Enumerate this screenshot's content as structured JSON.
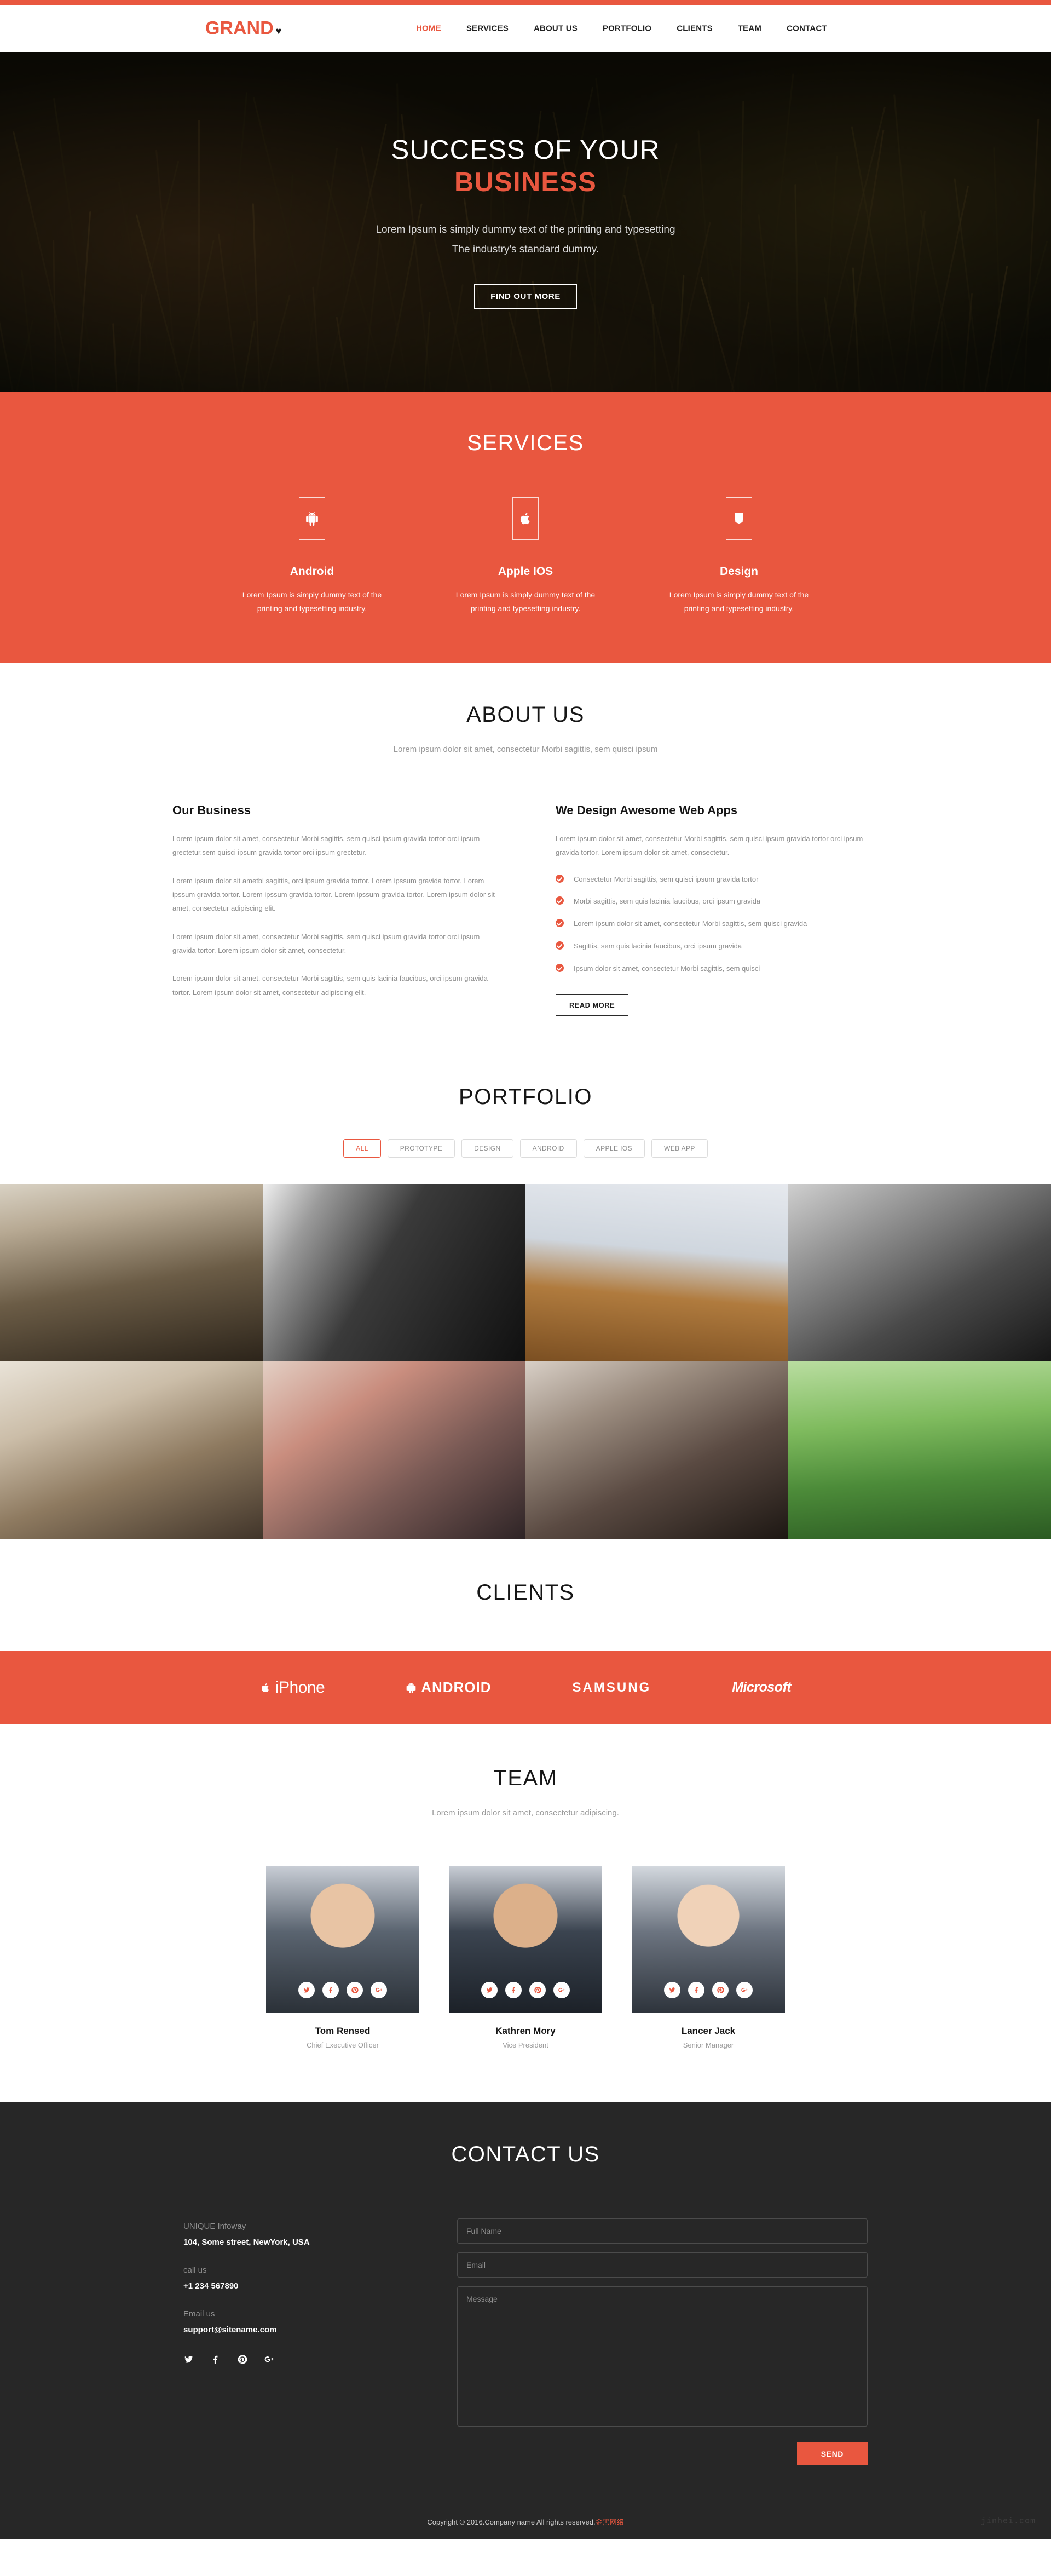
{
  "brand": {
    "name": "GRAND",
    "mark": "♥"
  },
  "nav": {
    "items": [
      {
        "label": "HOME",
        "active": true
      },
      {
        "label": "SERVICES",
        "active": false
      },
      {
        "label": "ABOUT US",
        "active": false
      },
      {
        "label": "PORTFOLIO",
        "active": false
      },
      {
        "label": "CLIENTS",
        "active": false
      },
      {
        "label": "TEAM",
        "active": false
      },
      {
        "label": "CONTACT",
        "active": false
      }
    ]
  },
  "hero": {
    "title_line1": "SUCCESS OF YOUR",
    "title_line2": "BUSINESS",
    "sub_line1": "Lorem Ipsum is simply dummy text of the printing and typesetting",
    "sub_line2": "The industry's standard dummy.",
    "button": "FIND OUT MORE"
  },
  "services": {
    "title": "SERVICES",
    "items": [
      {
        "icon": "android-icon",
        "name": "Android",
        "desc": "Lorem Ipsum is simply dummy text of the printing and typesetting industry."
      },
      {
        "icon": "apple-icon",
        "name": "Apple IOS",
        "desc": "Lorem Ipsum is simply dummy text of the printing and typesetting industry."
      },
      {
        "icon": "html5-icon",
        "name": "Design",
        "desc": "Lorem Ipsum is simply dummy text of the printing and typesetting industry."
      }
    ]
  },
  "about": {
    "title": "ABOUT US",
    "subtitle": "Lorem ipsum dolor sit amet, consectetur Morbi sagittis, sem quisci ipsum",
    "left": {
      "heading": "Our Business",
      "paragraphs": [
        "Lorem ipsum dolor sit amet, consectetur Morbi sagittis, sem quisci ipsum gravida tortor orci ipsum grectetur.sem quisci ipsum gravida tortor orci ipsum grectetur.",
        "Lorem ipsum dolor sit ametbi sagittis, orci ipsum gravida tortor. Lorem ipssum gravida tortor. Lorem ipssum gravida tortor. Lorem ipssum gravida tortor. Lorem ipssum gravida tortor. Lorem ipsum dolor sit amet, consectetur adipiscing elit.",
        "Lorem ipsum dolor sit amet, consectetur Morbi sagittis, sem quisci ipsum gravida tortor orci ipsum gravida tortor. Lorem ipsum dolor sit amet, consectetur.",
        "Lorem ipsum dolor sit amet, consectetur Morbi sagittis, sem quis lacinia faucibus, orci ipsum gravida tortor. Lorem ipsum dolor sit amet, consectetur adipiscing elit."
      ]
    },
    "right": {
      "heading": "We Design Awesome Web Apps",
      "intro": "Lorem ipsum dolor sit amet, consectetur Morbi sagittis, sem quisci ipsum gravida tortor orci ipsum gravida tortor. Lorem ipsum dolor sit amet, consectetur.",
      "checks": [
        "Consectetur Morbi sagittis, sem quisci ipsum gravida tortor",
        "Morbi sagittis, sem quis lacinia faucibus, orci ipsum gravida",
        "Lorem ipsum dolor sit amet, consectetur Morbi sagittis, sem quisci gravida",
        "Sagittis, sem quis lacinia faucibus, orci ipsum gravida",
        "Ipsum dolor sit amet, consectetur Morbi sagittis, sem quisci"
      ],
      "button": "READ MORE"
    }
  },
  "portfolio": {
    "title": "PORTFOLIO",
    "filters": [
      {
        "label": "ALL",
        "active": true
      },
      {
        "label": "PROTOTYPE",
        "active": false
      },
      {
        "label": "DESIGN",
        "active": false
      },
      {
        "label": "ANDROID",
        "active": false
      },
      {
        "label": "APPLE IOS",
        "active": false
      },
      {
        "label": "WEB APP",
        "active": false
      }
    ],
    "tiles": [
      {
        "alt": "audio-mixing-console"
      },
      {
        "alt": "vintage-tape-recorder"
      },
      {
        "alt": "laptop-glasses-on-wooden-desk"
      },
      {
        "alt": "headphones-black-and-white"
      },
      {
        "alt": "hands-writing-notebook-laptop"
      },
      {
        "alt": "red-headphones-closeup"
      },
      {
        "alt": "man-using-macbook"
      },
      {
        "alt": "laptop-on-green-grass"
      }
    ]
  },
  "clients": {
    "title": "CLIENTS",
    "logos": [
      {
        "name": "iPhone",
        "icon": "apple-icon"
      },
      {
        "name": "ANDROID",
        "icon": "android-icon"
      },
      {
        "name": "SAMSUNG",
        "icon": ""
      },
      {
        "name": "Microsoft",
        "icon": ""
      }
    ]
  },
  "team": {
    "title": "TEAM",
    "subtitle": "Lorem ipsum dolor sit amet, consectetur adipiscing.",
    "members": [
      {
        "name": "Tom Rensed",
        "role": "Chief Executive Officer",
        "socials": [
          "twitter-icon",
          "facebook-icon",
          "pinterest-icon",
          "google-plus-icon"
        ]
      },
      {
        "name": "Kathren Mory",
        "role": "Vice President",
        "socials": [
          "twitter-icon",
          "facebook-icon",
          "pinterest-icon",
          "google-plus-icon"
        ]
      },
      {
        "name": "Lancer Jack",
        "role": "Senior Manager",
        "socials": [
          "twitter-icon",
          "facebook-icon",
          "pinterest-icon",
          "google-plus-icon"
        ]
      }
    ]
  },
  "contact": {
    "title": "CONTACT US",
    "company_label": "UNIQUE Infoway",
    "address": "104, Some street, NewYork, USA",
    "call_label": "call us",
    "phone": "+1 234 567890",
    "email_label": "Email us",
    "email": "support@sitename.com",
    "socials": [
      "twitter-icon",
      "facebook-icon",
      "pinterest-icon",
      "google-plus-icon"
    ],
    "form": {
      "name_placeholder": "Full Name",
      "email_placeholder": "Email",
      "message_placeholder": "Message",
      "send_label": "SEND"
    }
  },
  "footer": {
    "copyright": "Copyright © 2016.Company name All rights reserved.",
    "credit": "金黑网络",
    "watermark": "jinhei.com"
  },
  "colors": {
    "accent": "#e9573f",
    "dark": "#272727",
    "muted": "#8d8d8d"
  }
}
